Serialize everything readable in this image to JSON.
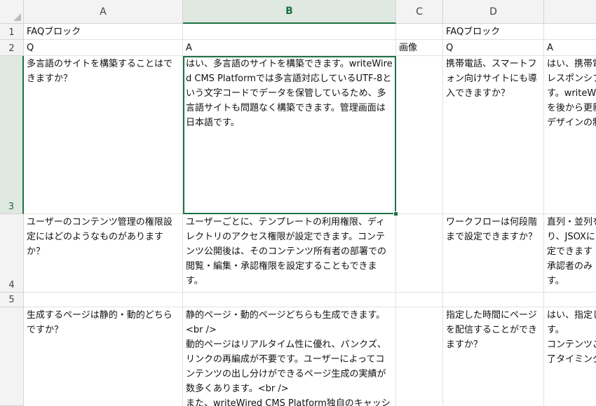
{
  "columns": [
    "A",
    "B",
    "C",
    "D"
  ],
  "rows": [
    "1",
    "2",
    "3",
    "4",
    "5"
  ],
  "cells": {
    "A1": "FAQブロック",
    "D1": "FAQブロック",
    "A2": "Q",
    "B2": "A",
    "C2": "画像",
    "D2": "Q",
    "E2": "A",
    "A3": "多言語のサイトを構築することはできますか？",
    "B3": "はい、多言語のサイトを構築できます。writeWired CMS Platformでは多言語対応しているUTF-8という文字コードでデータを保管しているため、多言語サイトも問題なく構築できます。管理画面は日本語です。",
    "D3": "携帯電話、スマートフォン向けサイトにも導入できますか？",
    "E3": "はい、携帯電\nレスポンシブ\nす。writeW\nを後から更新\nデザインの制",
    "A4": "ユーザーのコンテンツ管理の権限設定にはどのようなものがありますか？",
    "B4": "ユーザーごとに、テンプレートの利用権限、ディレクトリのアクセス権限が設定できます。コンテンツ公開後は、そのコンテンツ所有者の部署での閲覧・編集・承認権限を設定することもできます。",
    "D4": "ワークフローは何段階まで設定できますか？",
    "E4": "直列・並列を\nり、JSOXに\n定できます\n承認者のみ\nす。",
    "A6": "生成するページは静的・動的どちらですか？",
    "B6": "静的ページ・動的ページどちらも生成できます。<br />\n動的ページはリアルタイム性に優れ、パンクズ、リンクの再編成が不要です。ユーザーによってコンテンツの出し分けができるページ生成の実績が数多くあります。<br />\nまた、writeWired CMS Platform独自のキャッシュ",
    "D6": "指定した時間にページを配信することができますか？",
    "E6": "はい、指定し\nす。\nコンテンツご\n了タイミング"
  },
  "selected_cell": "B3"
}
